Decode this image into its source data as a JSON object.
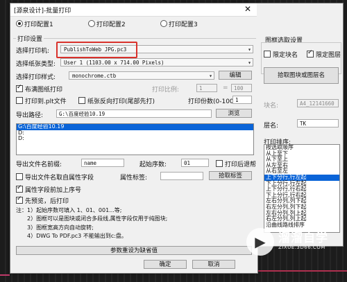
{
  "window": {
    "title": "[源泉设计]-批量打印",
    "close_glyph": "✕"
  },
  "configs": [
    "打印配置1",
    "打印配置2",
    "打印配置3"
  ],
  "print_settings": {
    "group_label": "打印设置",
    "printer_label": "选择打印机:",
    "printer_value": "PublishToWeb JPG.pc3",
    "paper_label": "选择纸张类型:",
    "paper_value": "User 1 (1103.00 x 714.00 Pixels)",
    "style_label": "选择打印样式:",
    "style_value": "monochrome.ctb",
    "edit_button": "编辑",
    "fill_print": "布满图纸打印",
    "scale_label": "打印比例:",
    "scale_a": "1",
    "scale_eq": "=",
    "scale_b": "100",
    "plt_file": "打印到.plt文件",
    "reverse": "纸张反向打印(尾部先打)",
    "copies_label": "打印份数(0-100):",
    "copies_value": "1"
  },
  "export": {
    "path_label": "导出路径:",
    "path_value": "G:\\百度经验10.19",
    "browse_button": "浏览",
    "drives": [
      "G:\\百度经验10.19",
      "D:",
      "D:"
    ]
  },
  "naming": {
    "prefix_label": "导出文件名前缀:",
    "prefix_value": "name",
    "start_label": "起始序数:",
    "start_value": "01",
    "open_after": "打印后退帮",
    "attr_name": "导出文件名取自属性字段",
    "attr_tag_label": "属性标签:",
    "extract_button": "拾取标签",
    "prepend_serial": "属性字段前加上序号",
    "preview": "先预览，后打印"
  },
  "notes": [
    "注：1）起始序数可填入 1、01、001...等;",
    "　　2）图框可以是图块或闭合多段线,属性字段仅用于纯图块;",
    "　　3）图框宽高方向自动旋转;",
    "　　4）DWG To PDF.pc3 不能输出到c:盘。"
  ],
  "defaults_button": "参数重设为缺省值",
  "ok_button": "确定",
  "cancel_button": "取消",
  "frame_pick": {
    "group_label": "图框选取设置",
    "limit_block": "限定块名",
    "limit_layer": "限定图层",
    "pick_button": "拾取图块或图层名",
    "block_label": "块名:",
    "block_value": "A4_12141660",
    "layer_label": "层名:",
    "layer_value": "TK",
    "order_label": "打印排序:",
    "orders": [
      "按选取顺序",
      "从上至下",
      "从下至上",
      "从左至右",
      "从右至左",
      "上下分行,行左起",
      "下上分行,行左起",
      "上下分行,行右起",
      "下上分行,行右起",
      "左右分列,列下起",
      "右左分列,列下起",
      "左右分列,列上起",
      "右左分列,列上起",
      "沿曲线路线排序"
    ],
    "selected_index": 5
  },
  "watermark": {
    "brand": "溜溜自学",
    "url": "ZIXUE.3D66.COM",
    "icon": "play-icon"
  }
}
